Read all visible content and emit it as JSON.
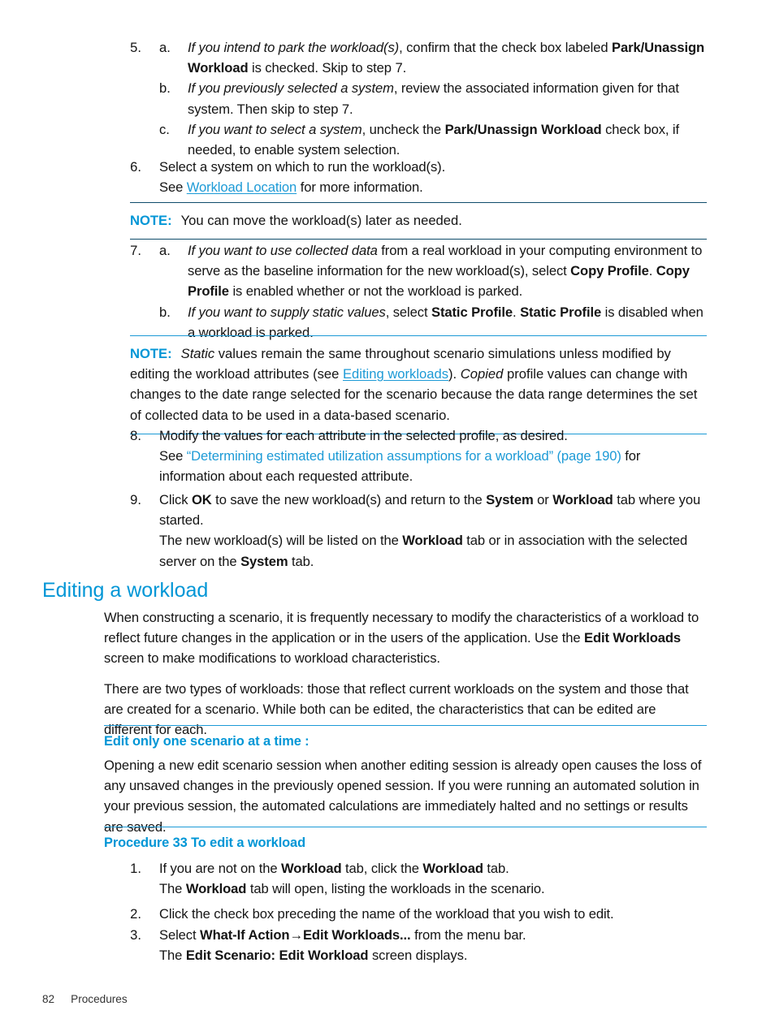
{
  "footer": {
    "page_number": "82",
    "section_label": "Procedures"
  },
  "colors": {
    "heading_blue": "#0096D6",
    "link_blue": "#1C9AD6",
    "note_rule": "#0F4C6B",
    "body_text": "#141414"
  },
  "steps": {
    "step5": {
      "num": "5.",
      "a": {
        "letter": "a.",
        "t1": "If you intend to park the workload(s)",
        "t2": ", confirm that the check box labeled ",
        "t3": "Park/Unassign Workload",
        "t4": " is checked. Skip to step 7."
      },
      "b": {
        "letter": "b.",
        "t1": "If you previously selected a system",
        "t2": ", review the associated information given for that system. Then skip to step 7."
      },
      "c": {
        "letter": "c.",
        "t1": "If you want to select a system",
        "t2": ", uncheck the ",
        "t3": "Park/Unassign Workload",
        "t4": " check box, if needed, to enable system selection."
      }
    },
    "step6": {
      "num": "6.",
      "t1": "Select a system on which to run the workload(s).",
      "see_prefix": "See ",
      "link": "Workload Location",
      "see_suffix": " for more information."
    },
    "note1": {
      "label": "NOTE:",
      "text": "You can move the workload(s) later as needed."
    },
    "step7": {
      "num": "7.",
      "a": {
        "letter": "a.",
        "t1": "If you want to use collected data",
        "t2": " from a real workload in your computing environment to serve as the baseline information for the new workload(s), select ",
        "t3": "Copy Profile",
        "t4": ". ",
        "t5": "Copy Profile",
        "t6": " is enabled whether or not the workload is parked."
      },
      "b": {
        "letter": "b.",
        "t1": "If you want to supply static values",
        "t2": ", select ",
        "t3": "Static Profile",
        "t4": ". ",
        "t5": "Static Profile",
        "t6": " is disabled when a workload is parked."
      }
    },
    "note2": {
      "label": "NOTE:",
      "t1": "Static",
      "t2": " values remain the same throughout scenario simulations unless modified by editing the workload attributes (see ",
      "link": "Editing workloads",
      "t3": "). ",
      "t4": "Copied",
      "t5": " profile values can change with changes to the date range selected for the scenario because the data range determines the set of collected data to be used in a data-based scenario."
    },
    "step8": {
      "num": "8.",
      "t1": "Modify the values for each attribute in the selected profile, as desired.",
      "see_prefix": "See ",
      "link": "“Determining estimated utilization assumptions for a workload” (page 190)",
      "see_suffix": " for information about each requested attribute."
    },
    "step9": {
      "num": "9.",
      "t1": "Click ",
      "t2": "OK",
      "t3": " to save the new workload(s) and return to the ",
      "t4": "System",
      "t5": " or ",
      "t6": "Workload",
      "t7": " tab where you started.",
      "r1": "The new workload(s) will be listed on the ",
      "r2": "Workload",
      "r3": " tab or in association with the selected server on the ",
      "r4": "System",
      "r5": " tab."
    }
  },
  "section": {
    "heading": "Editing a workload",
    "para1_a": "When constructing a scenario, it is frequently necessary to modify the characteristics of a workload to reflect future changes in the application or in the users of the application. Use the ",
    "para1_b": "Edit Workloads",
    "para1_c": " screen to make modifications to workload characteristics.",
    "para2": "There are two types of workloads: those that reflect current workloads on the system and those that are created for a scenario. While both can be edited, the characteristics that can be edited are different for each."
  },
  "caution": {
    "heading": "Edit only one scenario at a time :",
    "body": "Opening a new edit scenario session when another editing session is already open causes the loss of any unsaved changes in the previously opened session. If you were running an automated solution in your previous session, the automated calculations are immediately halted and no settings or results are saved."
  },
  "procedure": {
    "heading": "Procedure 33 To edit a workload",
    "step1": {
      "num": "1.",
      "t1": "If you are not on the ",
      "t2": "Workload",
      "t3": " tab, click the ",
      "t4": "Workload",
      "t5": " tab.",
      "r1": "The ",
      "r2": "Workload",
      "r3": " tab will open, listing the workloads in the scenario."
    },
    "step2": {
      "num": "2.",
      "t1": "Click the check box preceding the name of the workload that you wish to edit."
    },
    "step3": {
      "num": "3.",
      "t1": "Select ",
      "t2": "What-If Action→Edit Workloads...",
      "t3": " from the menu bar.",
      "r1": "The ",
      "r2": "Edit Scenario: Edit Workload",
      "r3": " screen displays."
    }
  }
}
